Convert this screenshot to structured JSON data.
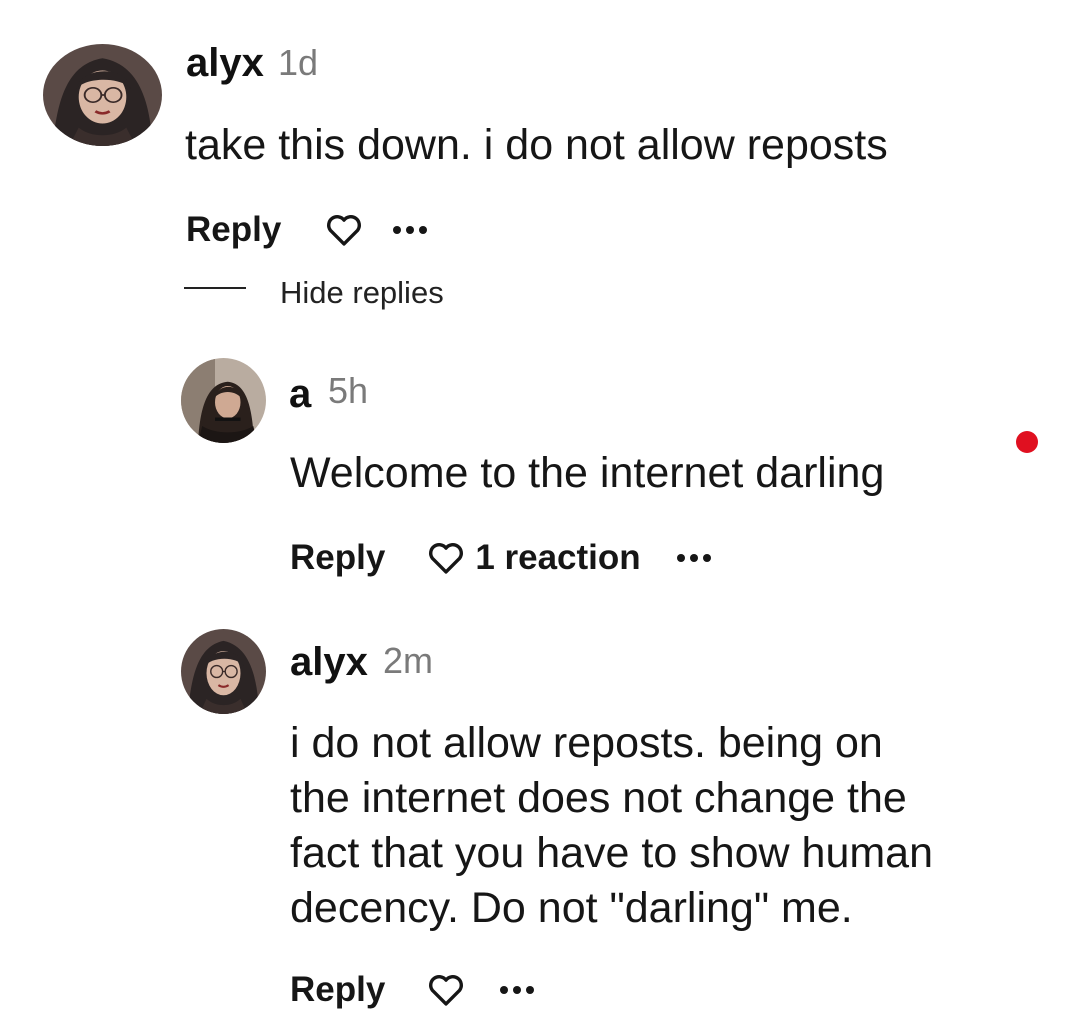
{
  "comment": {
    "author": "alyx",
    "time": "1d",
    "text": "take this down. i do not allow reposts",
    "reply_label": "Reply",
    "heart_icon": "heart-outline-icon",
    "more_icon": "more-dots-icon"
  },
  "hide_replies_label": "Hide replies",
  "replies": [
    {
      "author": "a",
      "time": "5h",
      "text": "Welcome to the internet darling",
      "reply_label": "Reply",
      "reaction_label": "1 reaction"
    },
    {
      "author": "alyx",
      "time": "2m",
      "text_lines": [
        "i do not allow reposts. being on",
        "the internet does not change the",
        "fact that you have to show human",
        "decency. Do not \"darling\" me."
      ],
      "reply_label": "Reply"
    }
  ],
  "colors": {
    "text": "#161616",
    "timestamp": "#7a7a7a",
    "notification_dot": "#e01020"
  }
}
